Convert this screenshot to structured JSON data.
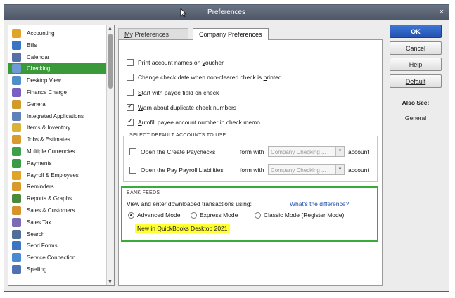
{
  "window": {
    "title": "Preferences",
    "close_label": "×"
  },
  "sidebar": {
    "items": [
      {
        "label": "Accounting",
        "icon": "accounting-icon",
        "color": "#e0a428",
        "selected": false
      },
      {
        "label": "Bills",
        "icon": "bills-icon",
        "color": "#3c74c4",
        "selected": false
      },
      {
        "label": "Calendar",
        "icon": "calendar-icon",
        "color": "#5470a8",
        "selected": false
      },
      {
        "label": "Checking",
        "icon": "checking-icon",
        "color": "#6f9ad8",
        "selected": true
      },
      {
        "label": "Desktop View",
        "icon": "desktop-view-icon",
        "color": "#4f8ec6",
        "selected": false
      },
      {
        "label": "Finance Charge",
        "icon": "finance-charge-icon",
        "color": "#7a5ec4",
        "selected": false
      },
      {
        "label": "General",
        "icon": "general-icon",
        "color": "#d29a28",
        "selected": false
      },
      {
        "label": "Integrated Applications",
        "icon": "integrated-apps-icon",
        "color": "#5f7fb8",
        "selected": false
      },
      {
        "label": "Items & Inventory",
        "icon": "items-inventory-icon",
        "color": "#d8b23a",
        "selected": false
      },
      {
        "label": "Jobs & Estimates",
        "icon": "jobs-estimates-icon",
        "color": "#d99a30",
        "selected": false
      },
      {
        "label": "Multiple Currencies",
        "icon": "currencies-icon",
        "color": "#3fa04a",
        "selected": false
      },
      {
        "label": "Payments",
        "icon": "payments-icon",
        "color": "#3a9a4a",
        "selected": false
      },
      {
        "label": "Payroll & Employees",
        "icon": "payroll-icon",
        "color": "#e0a428",
        "selected": false
      },
      {
        "label": "Reminders",
        "icon": "reminders-icon",
        "color": "#d89a28",
        "selected": false
      },
      {
        "label": "Reports & Graphs",
        "icon": "reports-graphs-icon",
        "color": "#4a8a3a",
        "selected": false
      },
      {
        "label": "Sales & Customers",
        "icon": "sales-customers-icon",
        "color": "#d8922a",
        "selected": false
      },
      {
        "label": "Sales Tax",
        "icon": "sales-tax-icon",
        "color": "#7b6ab4",
        "selected": false
      },
      {
        "label": "Search",
        "icon": "search-icon",
        "color": "#4f6e9a",
        "selected": false
      },
      {
        "label": "Send Forms",
        "icon": "send-forms-icon",
        "color": "#3f74c0",
        "selected": false
      },
      {
        "label": "Service Connection",
        "icon": "service-connection-icon",
        "color": "#4a8ad0",
        "selected": false
      },
      {
        "label": "Spelling",
        "icon": "spelling-icon",
        "color": "#4f72b4",
        "selected": false
      }
    ]
  },
  "tabs": {
    "my": {
      "prefix": "M",
      "rest": "y Preferences"
    },
    "company": {
      "label": "Company Preferences"
    }
  },
  "checkboxes": [
    {
      "pre": "Print account names on ",
      "u": "v",
      "post": "oucher",
      "checked": false
    },
    {
      "pre": "Change check date when non-cleared check is ",
      "u": "p",
      "post": "rinted",
      "checked": false
    },
    {
      "pre": "",
      "u": "S",
      "post": "tart with payee field on check",
      "checked": false
    },
    {
      "pre": "",
      "u": "W",
      "post": "arn about duplicate check numbers",
      "checked": true
    },
    {
      "pre": "",
      "u": "A",
      "post": "utofill payee account number in check memo",
      "checked": true
    }
  ],
  "default_accounts": {
    "title": "SELECT DEFAULT ACCOUNTS TO USE",
    "rows": [
      {
        "label": "Open the Create Paychecks",
        "form_with": "form with",
        "dropdown": "Company Checking ...",
        "suffix": "account"
      },
      {
        "label": "Open the Pay Payroll Liabilities",
        "form_with": "form with",
        "dropdown": "Company Checking ...",
        "suffix": "account"
      }
    ]
  },
  "bank_feeds": {
    "title": "BANK FEEDS",
    "prompt": "View and enter downloaded transactions using:",
    "link": "What's the difference?",
    "modes": [
      {
        "label": "Advanced Mode",
        "selected": true
      },
      {
        "label": "Express Mode",
        "selected": false
      },
      {
        "label": "Classic Mode (Register Mode)",
        "selected": false
      }
    ],
    "note": "New in QuickBooks Desktop 2021"
  },
  "buttons": {
    "ok": "OK",
    "cancel": "Cancel",
    "help": "Help",
    "default": "Default"
  },
  "also_see": {
    "heading": "Also See:",
    "link": "General"
  },
  "colors": {
    "accent_green": "#3aaa3a",
    "selected_green": "#3a9a3a",
    "ok_blue": "#2a5fc4",
    "highlight_yellow": "#ffff33",
    "link_blue": "#1f4fa8"
  }
}
